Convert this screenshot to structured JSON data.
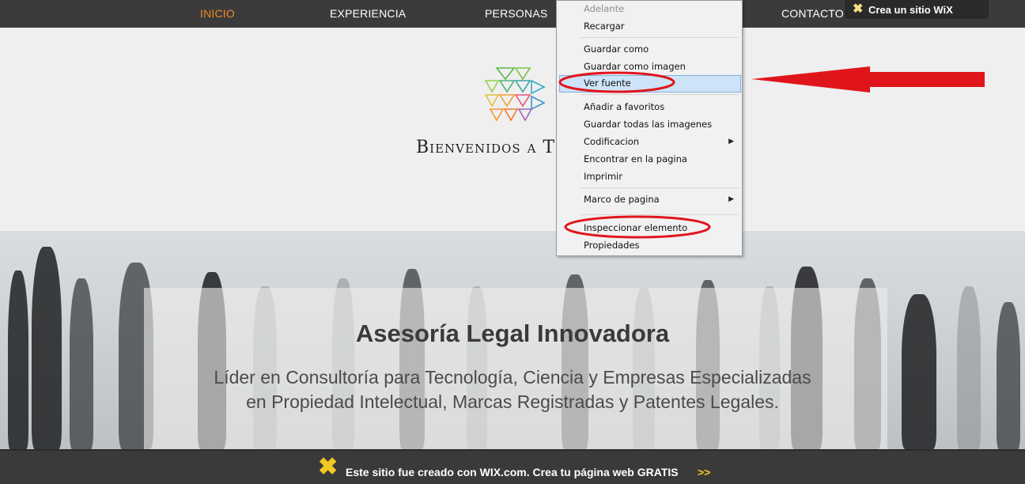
{
  "nav": {
    "items": [
      "INICIO",
      "EXPERIENCIA",
      "PERSONAS",
      "CONTACTO"
    ],
    "active": "INICIO"
  },
  "wix_pill": {
    "label": "Crea un sitio WiX"
  },
  "header": {
    "welcome": "Bienvenidos a TechN"
  },
  "hero": {
    "title": "Asesoría Legal Innovadora",
    "subtitle_line1": "Líder en Consultoría para Tecnología, Ciencia y Empresas Especializadas",
    "subtitle_line2": "en Propiedad Intelectual, Marcas Registradas y Patentes Legales."
  },
  "banner": {
    "text": "Este sitio fue creado con WIX.com. Crea tu página web GRATIS",
    "arrow": ">>"
  },
  "context_menu": {
    "adelante": "Adelante",
    "recargar": "Recargar",
    "guardar_como": "Guardar como",
    "guardar_como_imagen": "Guardar como imagen",
    "ver_fuente": "Ver fuente",
    "anadir_favoritos": "Añadir a favoritos",
    "guardar_imagenes": "Guardar todas las imagenes",
    "codificacion": "Codificacion",
    "encontrar": "Encontrar en la pagina",
    "imprimir": "Imprimir",
    "marco": "Marco de pagina",
    "inspeccionar": "Inspeccionar elemento",
    "propiedades": "Propiedades"
  },
  "colors": {
    "nav_bg": "#3b3b3b",
    "nav_active": "#f08a24",
    "annotation_red": "#e0151c",
    "wix_yellow": "#f3c824"
  }
}
